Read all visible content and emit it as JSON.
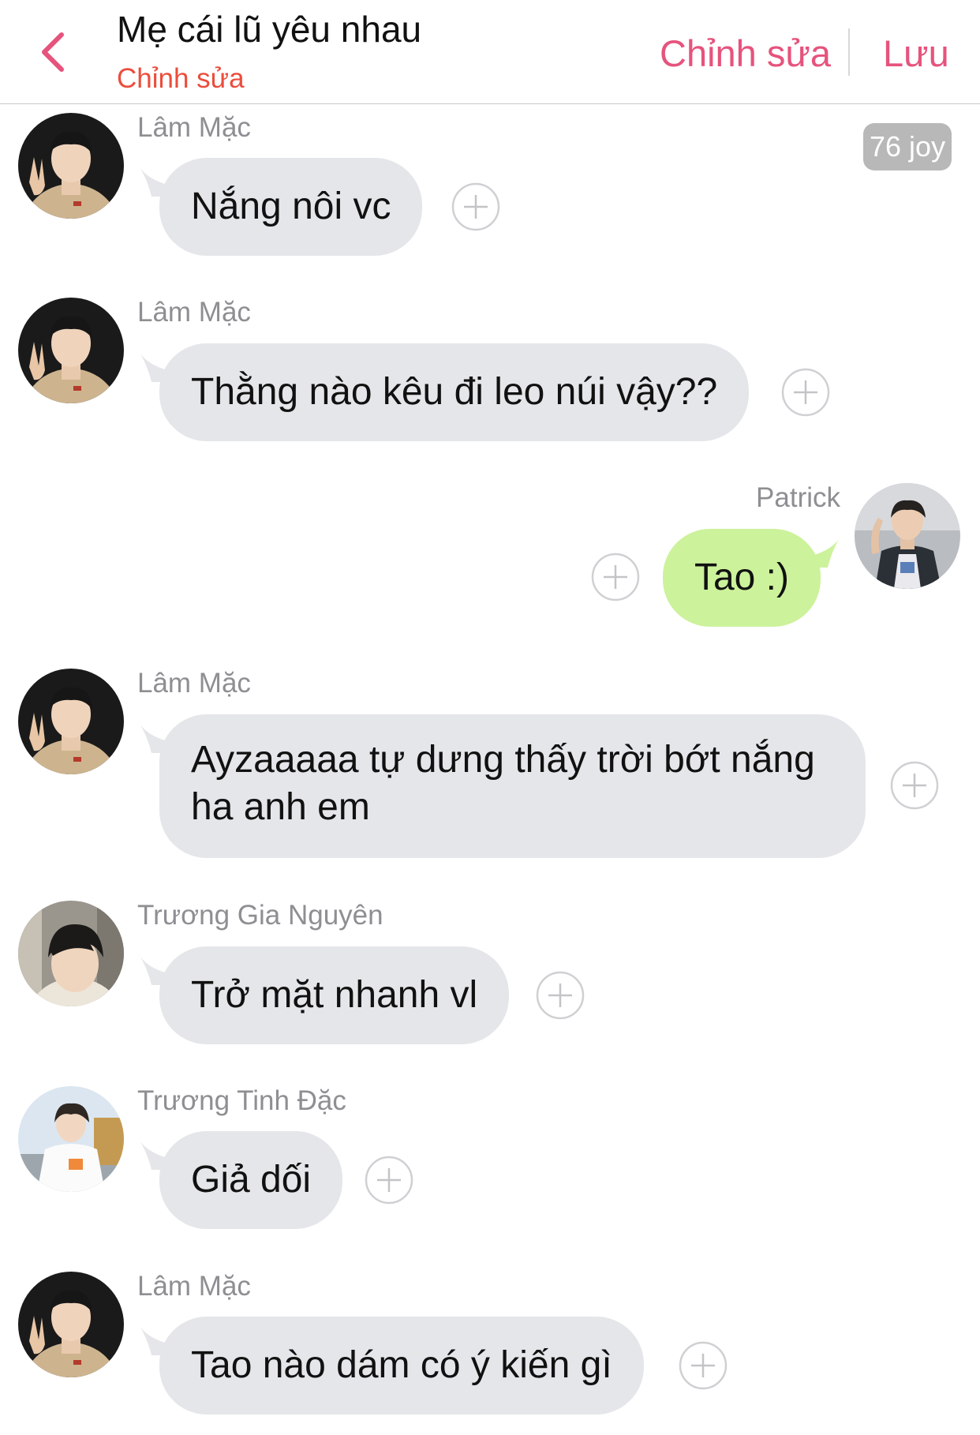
{
  "header": {
    "title": "Mẹ cái lũ yêu nhau",
    "subtitle": "Chỉnh sửa",
    "edit_label": "Chỉnh sửa",
    "save_label": "Lưu"
  },
  "joy_badge": "76 joy",
  "colors": {
    "accent": "#e6537d",
    "subtitle": "#ec4d3c",
    "incoming_bubble": "#e4e6e9",
    "outgoing_bubble": "#ccf29b",
    "sender_name": "#8e8e93"
  },
  "messages": [
    {
      "sender": "Lâm Mặc",
      "text": "Nắng nôi vc",
      "direction": "incoming"
    },
    {
      "sender": "Lâm Mặc",
      "text": "Thằng nào kêu đi leo núi vậy??",
      "direction": "incoming"
    },
    {
      "sender": "Patrick",
      "text": "Tao :)",
      "direction": "outgoing"
    },
    {
      "sender": "Lâm Mặc",
      "text_line1": "Ayzaaaaa tự dưng thấy trời bớt nắng",
      "text_line2": "ha anh em",
      "direction": "incoming"
    },
    {
      "sender": "Trương Gia Nguyên",
      "text": "Trở mặt nhanh vl",
      "direction": "incoming"
    },
    {
      "sender": "Trương Tinh Đặc",
      "text": "Giả dối",
      "direction": "incoming"
    },
    {
      "sender": "Lâm Mặc",
      "text": "Tao nào dám có ý kiến gì",
      "direction": "incoming"
    }
  ]
}
